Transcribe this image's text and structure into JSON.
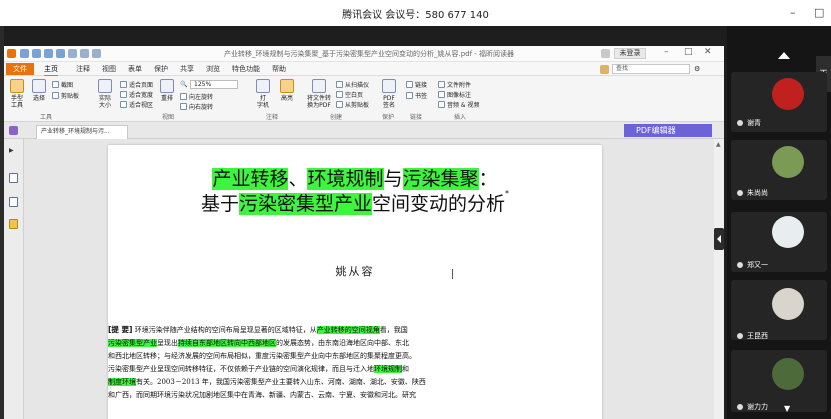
{
  "meeting": {
    "title": "腾讯会议 会议号：580 677 140",
    "minimize_glyph": "–",
    "maximize_glyph": "□"
  },
  "reader": {
    "doc_title": "产业转移_环境规制与污染集聚_基于污染密集型产业空间变动的分析_姚从容.pdf - 福昕阅读器",
    "login_label": "未登录",
    "menu": [
      "文件",
      "主页",
      "注释",
      "视图",
      "表单",
      "保护",
      "共享",
      "浏览",
      "特色功能",
      "帮助"
    ],
    "active_menu": "主页",
    "search_placeholder": "查找",
    "ribbon": {
      "hand_tool": "手型\n工具",
      "select": "选择",
      "screenshot": "截图",
      "clipboard": "剪贴板",
      "actual_size": "实际\n大小",
      "fit_page": "适合页面",
      "fit_width": "适合宽度",
      "fit_view": "适合视区",
      "reflow": "重排",
      "zoom_value": "125%",
      "rotate_left": "向左旋转",
      "rotate_right": "向右旋转",
      "typewriter": "打\n字机",
      "highlight": "高亮",
      "convert": "将文件转\n换为PDF",
      "from_scanner": "从扫描仪",
      "blank_page": "空白页",
      "from_clipboard": "从剪贴板",
      "pdf_sign": "PDF\n签名",
      "link": "链接",
      "bookmark": "书签",
      "file_attach": "文件附件",
      "image_annot": "图像标注",
      "audio_video": "音频 & 视频",
      "groups": [
        "工具",
        "视图",
        "注释",
        "创建",
        "保护",
        "链接",
        "插入"
      ]
    },
    "tab_label": "产业转移_环境规制与污...",
    "pdf_editor_label": "PDF编辑器",
    "paper": {
      "title_line1": [
        "产业转移",
        "、",
        "环境规制",
        "与",
        "污染集聚",
        "："
      ],
      "title_line2": [
        "基于",
        "污染密集型产业",
        "空间变动的分析"
      ],
      "footnote_mark": "*",
      "author": "姚从容",
      "abstract_label": "[提  要]",
      "abstract_lines": [
        [
          "环境污染伴随产业结构的空间布局呈现显著的区域特征，从",
          "产业转移的空间视角",
          "看，我国"
        ],
        [
          "污染密集型产业",
          "呈现出",
          "持续自东部地区转向中西部地区",
          "的发展态势，由东南沿海地区向中部、东北"
        ],
        [
          "和西北地区转移；与经济发展的空间布局相似，重度污染密集型产业向中东部地区的集聚程度更高。"
        ],
        [
          "污染密集型产业呈现空间转移特征，不仅依赖于产业链的空间演化规律，而且与迁入地",
          "环境规制",
          "和"
        ],
        [
          "制度环境",
          "有关。2003－2013 年，我国污染密集型产业主要转入山东、河南、湖南、湖北、安徽、陕西"
        ],
        [
          "和广西，而同期环境污染状况加剧地区集中在青海、新疆、内蒙古、云南、宁夏、安徽和河北。研究"
        ]
      ]
    }
  },
  "participants": [
    {
      "name": "谢青",
      "avatar_color": "#c0201e"
    },
    {
      "name": "朱尚尚",
      "avatar_color": "#7a9a55"
    },
    {
      "name": "郑又一",
      "avatar_color": "#e8eef0"
    },
    {
      "name": "王昆西",
      "avatar_color": "#d9d4cc"
    },
    {
      "name": "谢力力",
      "avatar_color": "#4d6a3a"
    }
  ],
  "colors": {
    "accent": "#e8730c",
    "highlight": "#3ef53e",
    "pdf_editor": "#6c63d9"
  }
}
